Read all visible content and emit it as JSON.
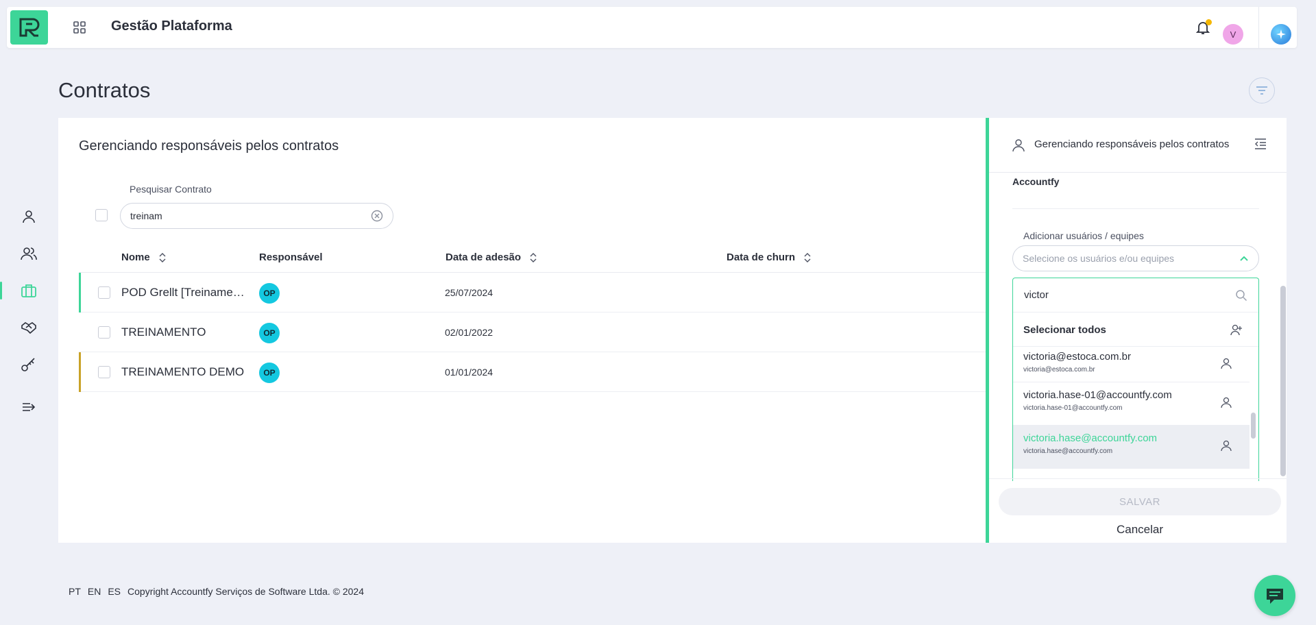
{
  "header": {
    "app_title": "Gestão Plataforma",
    "avatar_initial": "V",
    "icons": [
      "logo-icon",
      "apps-grid-icon",
      "bell-icon",
      "ai-sparkle-icon"
    ]
  },
  "page": {
    "title": "Contratos"
  },
  "sidebar": {
    "items": [
      {
        "name": "user-icon"
      },
      {
        "name": "users-icon"
      },
      {
        "name": "briefcase-icon",
        "active": true
      },
      {
        "name": "handshake-icon"
      },
      {
        "name": "key-icon"
      },
      {
        "name": "expand-menu-icon"
      }
    ]
  },
  "main": {
    "card_title": "Gerenciando responsáveis pelos contratos",
    "search_label": "Pesquisar Contrato",
    "search_value": "treinam",
    "columns": [
      "Nome",
      "Responsável",
      "Data de adesão",
      "Data de churn"
    ],
    "rows": [
      {
        "name": "POD Grellt [Treinamento]",
        "responsavel": "OP",
        "data_adesao": "25/07/2024",
        "data_churn": "",
        "bar_color": "#3dd598"
      },
      {
        "name": "TREINAMENTO",
        "responsavel": "OP",
        "data_adesao": "02/01/2022",
        "data_churn": "",
        "bar_color": ""
      },
      {
        "name": "TREINAMENTO DEMO",
        "responsavel": "OP",
        "data_adesao": "01/01/2024",
        "data_churn": "",
        "bar_color": "#c9a227"
      }
    ]
  },
  "panel": {
    "title": "Gerenciando responsáveis pelos contratos",
    "company": "Accountfy",
    "add_label": "Adicionar usuários / equipes",
    "select_placeholder": "Selecione os usuários e/ou equipes",
    "dropdown_search": "victor",
    "select_all_label": "Selecionar todos",
    "items": [
      {
        "email": "victoria@estoca.com.br",
        "sub": "victoria@estoca.com.br",
        "active": false
      },
      {
        "email": "victoria.hase-01@accountfy.com",
        "sub": "victoria.hase-01@accountfy.com",
        "active": false
      },
      {
        "email": "victoria.hase@accountfy.com",
        "sub": "victoria.hase@accountfy.com",
        "active": true
      }
    ],
    "save_label": "SALVAR",
    "cancel_label": "Cancelar"
  },
  "footer": {
    "langs": [
      "PT",
      "EN",
      "ES"
    ],
    "copyright": "Copyright Accountfy Serviços de Software Ltda. © 2024"
  },
  "colors": {
    "accent": "#3dd598",
    "background": "#eef0f7",
    "avatar_op": "#14c8e0",
    "avatar_v": "#f0a6e8",
    "notification_dot": "#f5b700"
  }
}
